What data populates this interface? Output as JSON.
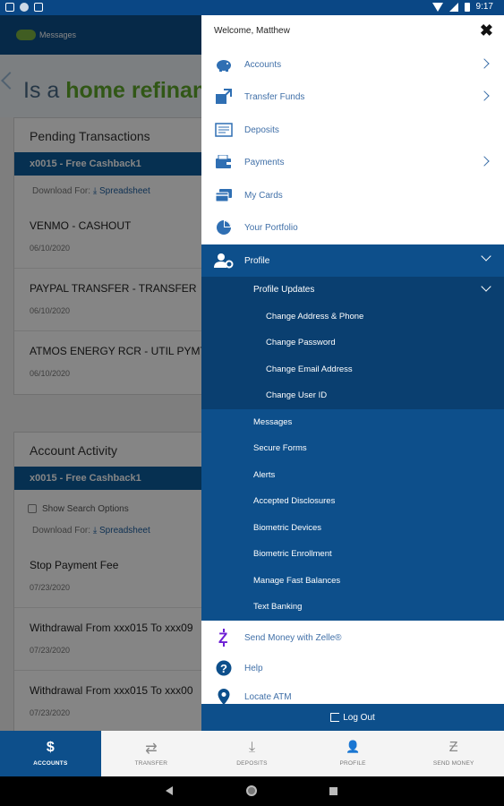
{
  "status": {
    "time": "9:17"
  },
  "app": {
    "header_label": "Messages",
    "banner": {
      "prefix": "Is a ",
      "highlight": "home refinan"
    },
    "pending": {
      "title": "Pending Transactions",
      "account": "x0015 - Free Cashback1",
      "download_label": "Download For:",
      "download_link": "Spreadsheet",
      "transactions": [
        {
          "name": "VENMO - CASHOUT",
          "date": "06/10/2020"
        },
        {
          "name": "PAYPAL TRANSFER - TRANSFER",
          "date": "06/10/2020"
        },
        {
          "name": "ATMOS ENERGY RCR - UTIL PYMT",
          "date": "06/10/2020"
        }
      ]
    },
    "activity": {
      "title": "Account Activity",
      "account": "x0015 - Free Cashback1",
      "show_search": "Show Search Options",
      "download_label": "Download For:",
      "download_link": "Spreadsheet",
      "transactions": [
        {
          "name": "Stop Payment Fee",
          "date": "07/23/2020"
        },
        {
          "name": "Withdrawal From xxx015 To xxx09",
          "date": "07/23/2020"
        },
        {
          "name": "Withdrawal From xxx015 To xxx00",
          "date": "07/23/2020"
        }
      ]
    }
  },
  "drawer": {
    "welcome": "Welcome, Matthew",
    "close_glyph": "✖",
    "items": [
      {
        "label": "Accounts",
        "icon": "piggy-bank-icon"
      },
      {
        "label": "Transfer Funds",
        "icon": "transfer-icon"
      },
      {
        "label": "Deposits",
        "icon": "check-deposit-icon"
      },
      {
        "label": "Payments",
        "icon": "wallet-icon"
      },
      {
        "label": "My Cards",
        "icon": "cards-icon"
      },
      {
        "label": "Your Portfolio",
        "icon": "pie-chart-icon"
      }
    ],
    "profile": {
      "label": "Profile",
      "icon": "user-gear-icon"
    },
    "profile_updates": {
      "label": "Profile Updates",
      "items": [
        "Change Address & Phone",
        "Change Password",
        "Change Email Address",
        "Change User ID"
      ]
    },
    "profile_items": [
      "Messages",
      "Secure Forms",
      "Alerts",
      "Accepted Disclosures",
      "Biometric Devices",
      "Biometric Enrollment",
      "Manage Fast Balances",
      "Text Banking"
    ],
    "bottom_items": [
      {
        "label": "Send Money with Zelle®",
        "icon": "zelle-icon"
      },
      {
        "label": "Help",
        "icon": "help-icon"
      },
      {
        "label": "Locate ATM",
        "icon": "location-pin-icon"
      }
    ],
    "logout": "Log Out"
  },
  "tabs": [
    {
      "label": "ACCOUNTS",
      "glyph": "$",
      "active": true
    },
    {
      "label": "TRANSFER",
      "glyph": "⇄",
      "active": false
    },
    {
      "label": "DEPOSITS",
      "glyph": "⤓",
      "active": false
    },
    {
      "label": "PROFILE",
      "glyph": "👤",
      "active": false
    },
    {
      "label": "SEND MONEY",
      "glyph": "Ƶ",
      "active": false
    }
  ],
  "colors": {
    "primary": "#0d4f8b",
    "submenu": "#0a3f70",
    "link": "#4170a8",
    "accent_green": "#5fa82b",
    "zelle": "#6d1ed4"
  }
}
